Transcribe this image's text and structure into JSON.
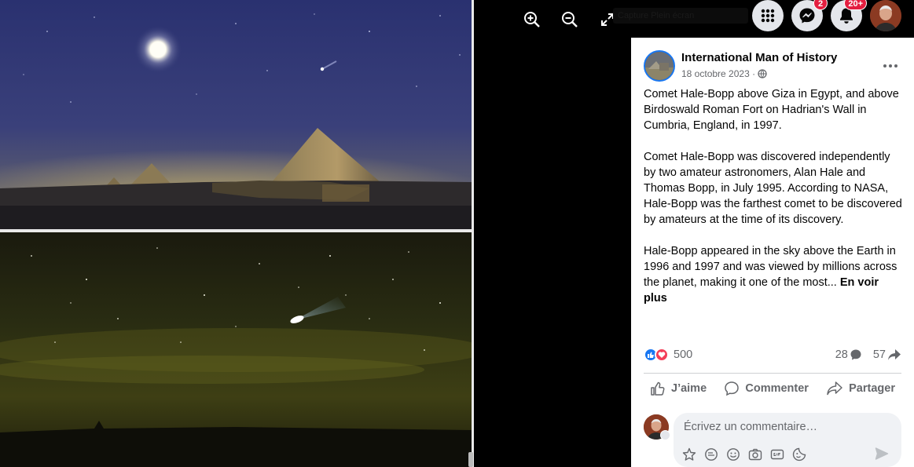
{
  "viewer": {
    "tools": [
      "zoom-in-icon",
      "zoom-out-icon",
      "fullscreen-icon"
    ],
    "fullscreen_tooltip": "Capture Plein écran"
  },
  "top_actions": {
    "menu_icon": "grid-menu-icon",
    "messenger_icon": "messenger-icon",
    "messenger_badge": "2",
    "notifications_icon": "bell-icon",
    "notifications_badge": "20+"
  },
  "post": {
    "page_name": "International Man of History",
    "date": "18 octobre 2023 ·",
    "privacy_icon": "globe-icon",
    "paragraphs": [
      "Comet Hale-Bopp above Giza in Egypt, and above Birdoswald Roman Fort on Hadrian's Wall in Cumbria, England, in 1997.",
      "Comet Hale-Bopp was discovered independently by two amateur astronomers, Alan Hale and Thomas Bopp, in July 1995. According to NASA, Hale-Bopp was the farthest comet to be discovered by amateurs at the time of its discovery.",
      "Hale-Bopp appeared in the sky above the Earth in 1996 and 1997 and was viewed by millions across the planet, making it one of the most..."
    ],
    "see_more": "En voir plus"
  },
  "stats": {
    "reactions": "500",
    "comments": "28",
    "shares": "57"
  },
  "actions": {
    "like": "J’aime",
    "comment": "Commenter",
    "share": "Partager"
  },
  "comment_box": {
    "placeholder": "Écrivez un commentaire…",
    "tools": [
      "avatar-sticker-icon",
      "sticker-icon",
      "emoji-icon",
      "camera-icon",
      "gif-icon",
      "sticker-face-icon"
    ]
  },
  "colors": {
    "accent": "#1877f2",
    "badge": "#e41e3f",
    "like_blue": "#1877f2",
    "love_red": "#f33e58"
  }
}
